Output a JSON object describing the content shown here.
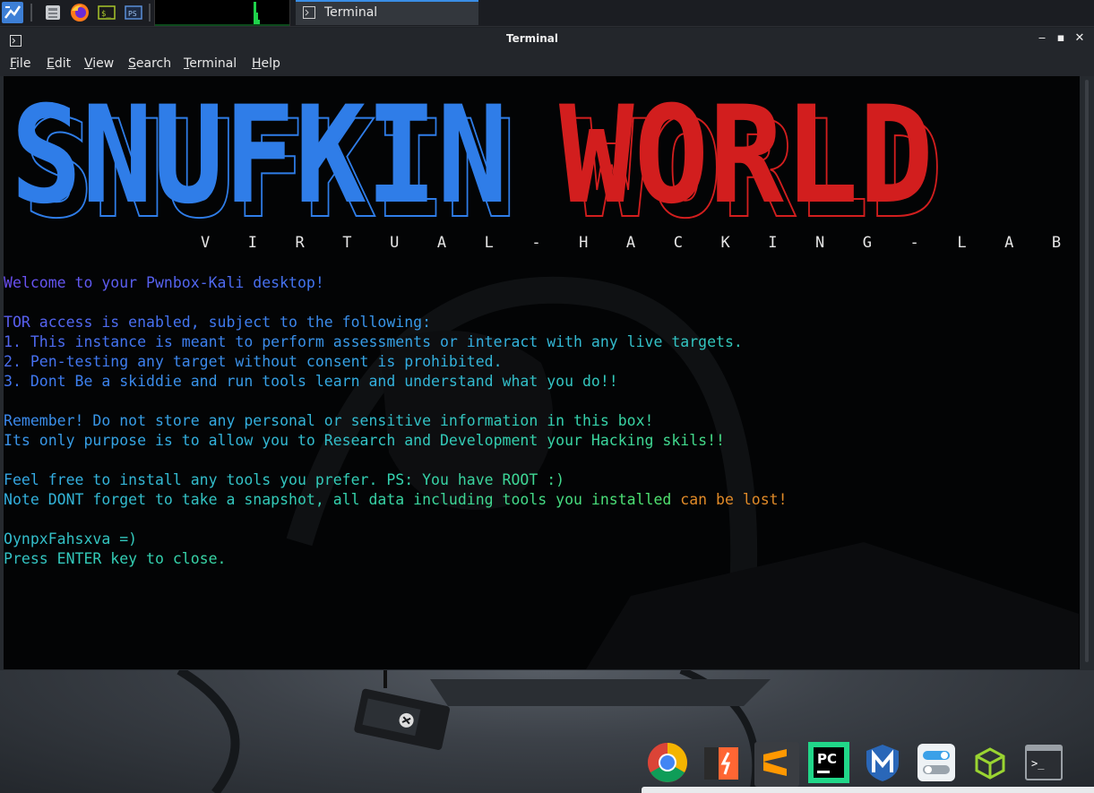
{
  "panel": {
    "task_title": "Terminal"
  },
  "window": {
    "title": "Terminal",
    "menu": [
      "File",
      "Edit",
      "View",
      "Search",
      "Terminal",
      "Help"
    ]
  },
  "terminal": {
    "banner_left": "SNUFKIN",
    "banner_right": "WORLD",
    "subtitle": "V I R T U A L - H A C K I N G - L A B",
    "lines": [
      "Welcome to your Pwnbox-Kali desktop!",
      "",
      "TOR access is enabled, subject to the following:",
      "1. This instance is meant to perform assessments or interact with any live targets.",
      "2. Pen-testing any target without consent is prohibited.",
      "3. Dont Be a skiddie and run tools learn and understand what you do!!",
      "",
      "Remember! Do not store any personal or sensitive information in this box!",
      "Its only purpose is to allow you to Research and Development your Hacking skils!!",
      "",
      "Feel free to install any tools you prefer. PS: You have ROOT :)",
      "Note DONT forget to take a snapshot, all data including tools you installed can be lost!",
      "",
      "OynpxFahsxva =)",
      "Press ENTER key to close."
    ],
    "colors": {
      "banner_blue": "#2f7de8",
      "banner_red": "#d21e1e",
      "line_gradient": [
        "#6a4ff0",
        "#3f78f0",
        "#33aee0",
        "#33d0b0",
        "#4ee070",
        "#7be040",
        "#e08a28"
      ]
    }
  },
  "dock": {
    "apps": [
      "chrome-icon",
      "burpsuite-icon",
      "sublime-icon",
      "pycharm-icon",
      "metasploit-icon",
      "settings-icon",
      "vm-icon",
      "terminal-icon"
    ]
  }
}
